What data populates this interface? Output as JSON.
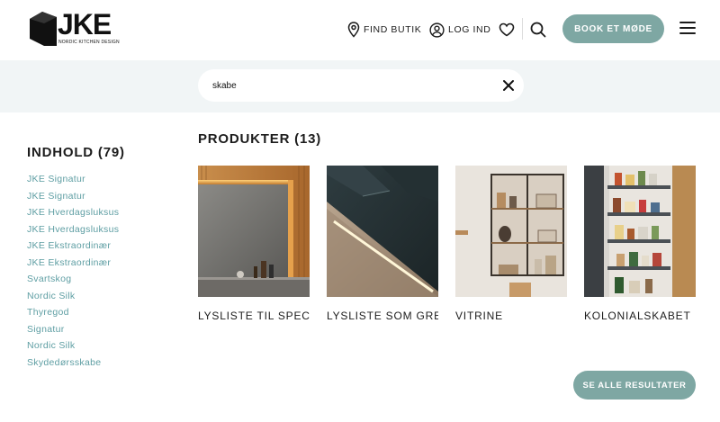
{
  "brand": {
    "name": "JKE",
    "tagline": "NORDIC KITCHEN DESIGN"
  },
  "nav": {
    "find_store": "FIND BUTIK",
    "login": "LOG IND",
    "book_meeting": "BOOK ET MØDE"
  },
  "icons": [
    "location-pin-icon",
    "user-circle-icon",
    "heart-icon",
    "search-icon",
    "close-icon",
    "hamburger-menu-icon"
  ],
  "search": {
    "value": "skabe"
  },
  "content": {
    "title": "INDHOLD (79)",
    "items": [
      "JKE Signatur",
      "JKE Signatur",
      "JKE Hverdagsluksus",
      "JKE Hverdagsluksus",
      "JKE Ekstraordinær",
      "JKE Ekstraordinær",
      "Svartskog",
      "Nordic Silk",
      "Thyregod",
      "Signatur",
      "Nordic Silk",
      "Skydedørsskabe"
    ]
  },
  "products": {
    "title": "PRODUKTER (13)",
    "items": [
      {
        "name": "LYSLISTE TIL SPECI..."
      },
      {
        "name": "LYSLISTE SOM GRE..."
      },
      {
        "name": "VITRINE"
      },
      {
        "name": "KOLONIALSKABET"
      }
    ]
  },
  "see_all": "SE ALLE RESULTATER",
  "colors": {
    "accent": "#7ea7a3",
    "link": "#5e9ea3",
    "band": "#f1f5f6"
  }
}
